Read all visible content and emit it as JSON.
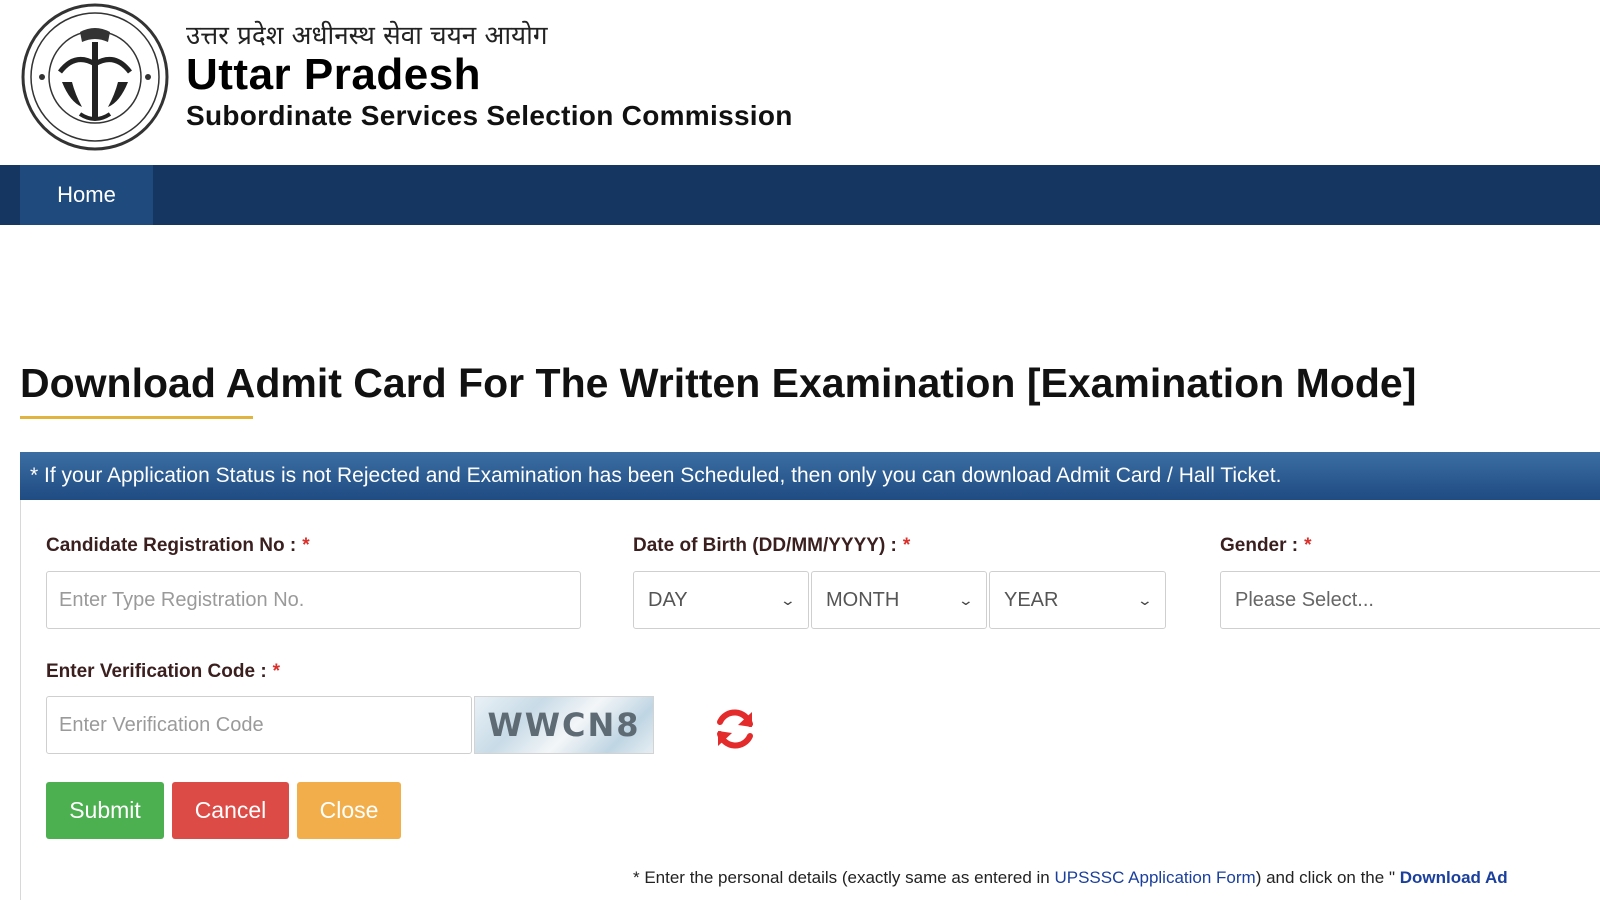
{
  "header": {
    "hindi_title": "उत्तर प्रदेश अधीनस्थ सेवा चयन आयोग",
    "title": "Uttar Pradesh",
    "subtitle": "Subordinate Services Selection Commission",
    "emblem_icon": "up-state-emblem-icon"
  },
  "nav": {
    "home_label": "Home",
    "bar_color": "#143660",
    "active_color": "#1f4a7d"
  },
  "page": {
    "title": "Download Admit Card For The Written Examination [Examination Mode]",
    "notice": "* If your Application Status is not Rejected and Examination has been Scheduled, then only you can download Admit Card / Hall Ticket.",
    "accent_color": "#e1b33f"
  },
  "form": {
    "registration": {
      "label": "Candidate Registration No :",
      "required_mark": "*",
      "placeholder": "Enter Type Registration No.",
      "value": ""
    },
    "dob": {
      "label": "Date of Birth (DD/MM/YYYY) :",
      "required_mark": "*",
      "day": "DAY",
      "month": "MONTH",
      "year": "YEAR"
    },
    "gender": {
      "label": "Gender :",
      "required_mark": "*",
      "selected": "Please Select..."
    },
    "verification": {
      "label": "Enter Verification Code :",
      "required_mark": "*",
      "placeholder": "Enter Verification Code",
      "value": "",
      "captcha_text": "WWCN8",
      "refresh_icon": "refresh-icon"
    },
    "buttons": {
      "submit": "Submit",
      "cancel": "Cancel",
      "close": "Close",
      "submit_color": "#4caf50",
      "cancel_color": "#dd4b46",
      "close_color": "#f2ae4a"
    }
  },
  "footnote": {
    "part1": "* Enter the personal details (exactly same as entered in ",
    "link": "UPSSSC Application Form",
    "part2": ") and click on the \" ",
    "bold": "Download Ad"
  }
}
